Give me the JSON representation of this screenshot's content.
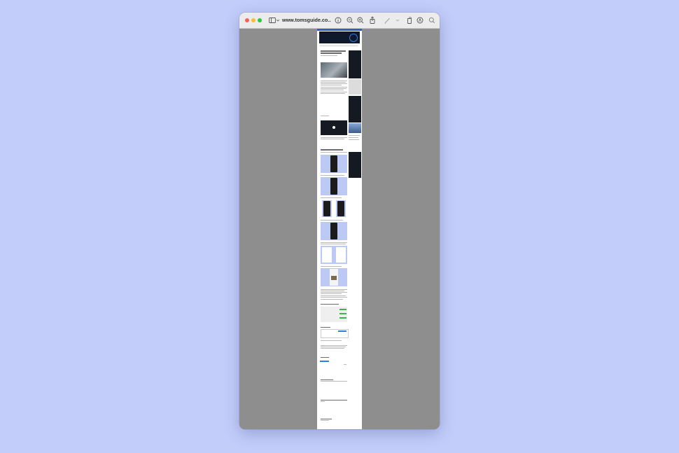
{
  "window": {
    "title": "www.tomsguide.co...",
    "traffic_lights": [
      "close",
      "minimize",
      "zoom"
    ]
  },
  "toolbar": {
    "icons": [
      "sidebar-icon",
      "chevron-down-icon",
      "info-icon",
      "zoom-out-icon",
      "zoom-in-icon",
      "share-icon",
      "markup-pen-icon",
      "chevron-down-icon",
      "rotate-icon",
      "annotate-icon",
      "search-icon"
    ]
  },
  "colors": {
    "desktop": "#c3cdfa",
    "viewer_bg": "#8e8e8e",
    "page": "#ffffff",
    "header_dark": "#10182c",
    "accent_blue": "#2f7de1",
    "accent_green": "#3cb64a"
  }
}
